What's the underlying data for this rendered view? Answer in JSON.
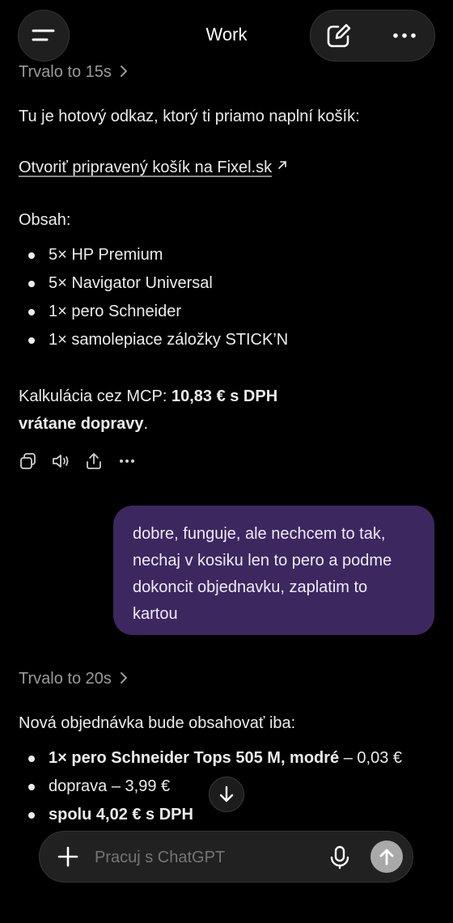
{
  "header": {
    "title": "Work",
    "menu_icon": "menu-icon",
    "edit_icon": "new-chat-icon",
    "more_icon": "more-icon"
  },
  "thread": {
    "thinking_1": "Trvalo to 15s",
    "intro": "Tu je hotový odkaz, ktorý ti priamo naplní košík:",
    "link_text": "Otvoriť pripravený košík na Fixel.sk",
    "contents_label": "Obsah:",
    "items": [
      "5× HP Premium",
      "5× Navigator Universal",
      "1× pero Schneider",
      "1× samolepiace záložky STICK’N"
    ],
    "calc_prefix": "Kalkulácia cez MCP: ",
    "calc_bold_1": "10,83 € s DPH",
    "calc_bold_2": "vrátane dopravy",
    "calc_suffix": ".",
    "user_message": "dobre, funguje, ale nechcem to tak, nechaj v kosiku len to pero a podme dokoncit objednavku, zaplatim to kartou",
    "thinking_2": "Trvalo to 20s",
    "new_order_intro": "Nová objednávka bude obsahovať iba:",
    "order_item_bold": "1× pero Schneider Tops 505 M, modré",
    "order_item_rest": " – 0,03 €",
    "order_shipping": "doprava – 3,99 €",
    "order_total": "spolu 4,02 € s DPH"
  },
  "composer": {
    "placeholder": "Pracuj s ChatGPT"
  },
  "colors": {
    "background": "#000000",
    "user_bubble": "#3d275f",
    "composer": "#212121",
    "muted_text": "#9a9a9a"
  }
}
